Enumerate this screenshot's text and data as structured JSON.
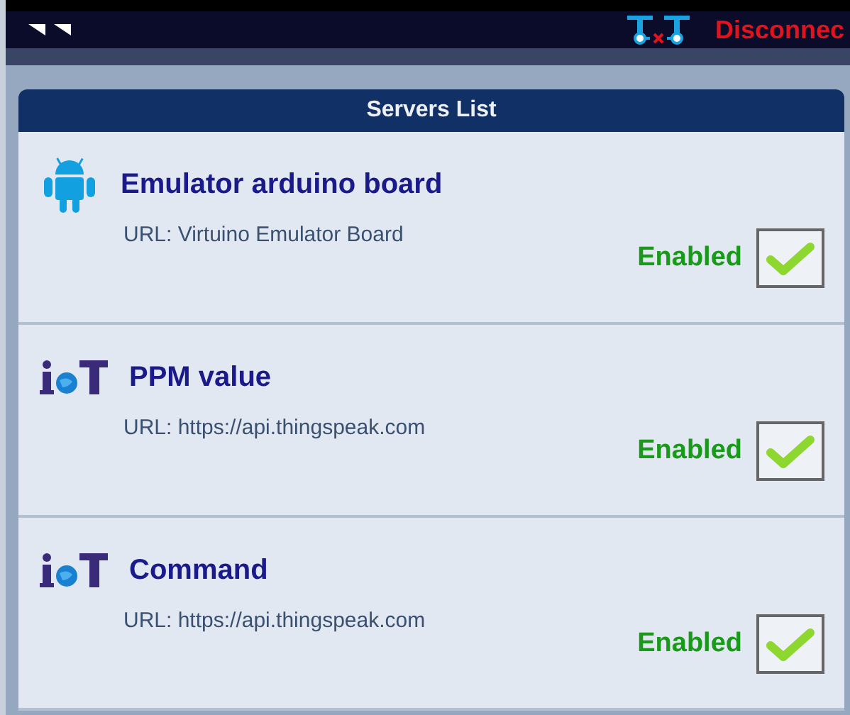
{
  "top_bar": {
    "connection_status": "Disconnec",
    "connected": false
  },
  "servers_list": {
    "title": "Servers List",
    "servers": [
      {
        "kind": "android",
        "name": "Emulator arduino board",
        "url": "URL:  Virtuino Emulator Board",
        "status": "Enabled",
        "enabled": true
      },
      {
        "kind": "iot",
        "name": "PPM value",
        "url": "URL:  https://api.thingspeak.com",
        "status": "Enabled",
        "enabled": true
      },
      {
        "kind": "iot",
        "name": "Command",
        "url": "URL:  https://api.thingspeak.com",
        "status": "Enabled",
        "enabled": true
      }
    ]
  }
}
